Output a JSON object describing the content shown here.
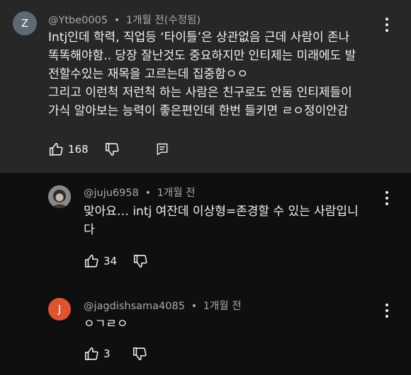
{
  "comments": [
    {
      "avatar_letter": "Z",
      "avatar_color": "#5e6a73",
      "author": "@Ytbe0005",
      "time": "1개월 전(수정됨)",
      "text": "Intj인데 학력, 직업등 ‘타이틀’은 상관없음 근데 사람이 존나\n똑똑해야함.. 당장 잘난것도 중요하지만 인티제는 미래에도 발\n전할수있는 재목을 고르는데 집중함ㅇㅇ\n그리고 이런척 저런척 하는 사람은 친구로도 안둠 인티제들이\n가식 알아보는 능력이 좋은편인데 한번 들키면 ㄹㅇ정이안감",
      "likes": "168"
    },
    {
      "author": "@juju6958",
      "time": "1개월 전",
      "text": "맞아요… intj 여잔데 이상형=존경할 수 있는 사람입니\n다",
      "likes": "34"
    },
    {
      "avatar_letter": "J",
      "avatar_color": "#e0532f",
      "author": "@jagdishsama4085",
      "time": "1개월 전",
      "text": "ㅇㄱㄹㅇ",
      "likes": "3"
    }
  ],
  "separator": "•"
}
